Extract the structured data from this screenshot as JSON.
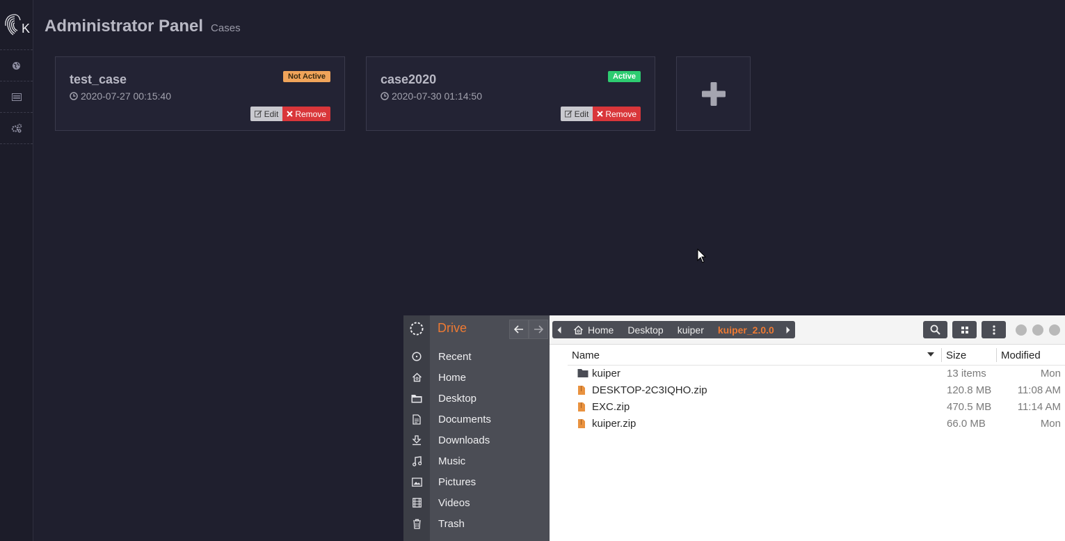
{
  "header": {
    "title": "Administrator Panel",
    "subtitle": "Cases"
  },
  "cases": [
    {
      "name": "test_case",
      "date": "2020-07-27 00:15:40",
      "status": "Not Active",
      "edit": "Edit",
      "remove": "Remove"
    },
    {
      "name": "case2020",
      "date": "2020-07-30 01:14:50",
      "status": "Active",
      "edit": "Edit",
      "remove": "Remove"
    }
  ],
  "rail": {
    "logo_letter": "K",
    "icons": [
      "globe-icon",
      "list-icon",
      "gears-icon"
    ]
  },
  "file_manager": {
    "title": "Drive",
    "sidebar": [
      {
        "label": "Recent",
        "icon": "clock-icon"
      },
      {
        "label": "Home",
        "icon": "home-icon"
      },
      {
        "label": "Desktop",
        "icon": "folder-icon"
      },
      {
        "label": "Documents",
        "icon": "document-icon"
      },
      {
        "label": "Downloads",
        "icon": "download-icon"
      },
      {
        "label": "Music",
        "icon": "music-icon"
      },
      {
        "label": "Pictures",
        "icon": "picture-icon"
      },
      {
        "label": "Videos",
        "icon": "film-icon"
      },
      {
        "label": "Trash",
        "icon": "trash-icon"
      }
    ],
    "breadcrumb": [
      "Home",
      "Desktop",
      "kuiper",
      "kuiper_2.0.0"
    ],
    "columns": {
      "name": "Name",
      "size": "Size",
      "modified": "Modified"
    },
    "files": [
      {
        "name": "kuiper",
        "size": "13 items",
        "modified": "Mon",
        "type": "folder"
      },
      {
        "name": "DESKTOP-2C3IQHO.zip",
        "size": "120.8 MB",
        "modified": "11:08 AM",
        "type": "zip"
      },
      {
        "name": "EXC.zip",
        "size": "470.5 MB",
        "modified": "11:14 AM",
        "type": "zip"
      },
      {
        "name": "kuiper.zip",
        "size": "66.0 MB",
        "modified": "Mon",
        "type": "zip"
      }
    ]
  },
  "colors": {
    "background": "#1f1f2e",
    "active": "#2ecc71",
    "inactive": "#f0a45a",
    "remove": "#d9363a",
    "accent_orange": "#ee7a33"
  }
}
